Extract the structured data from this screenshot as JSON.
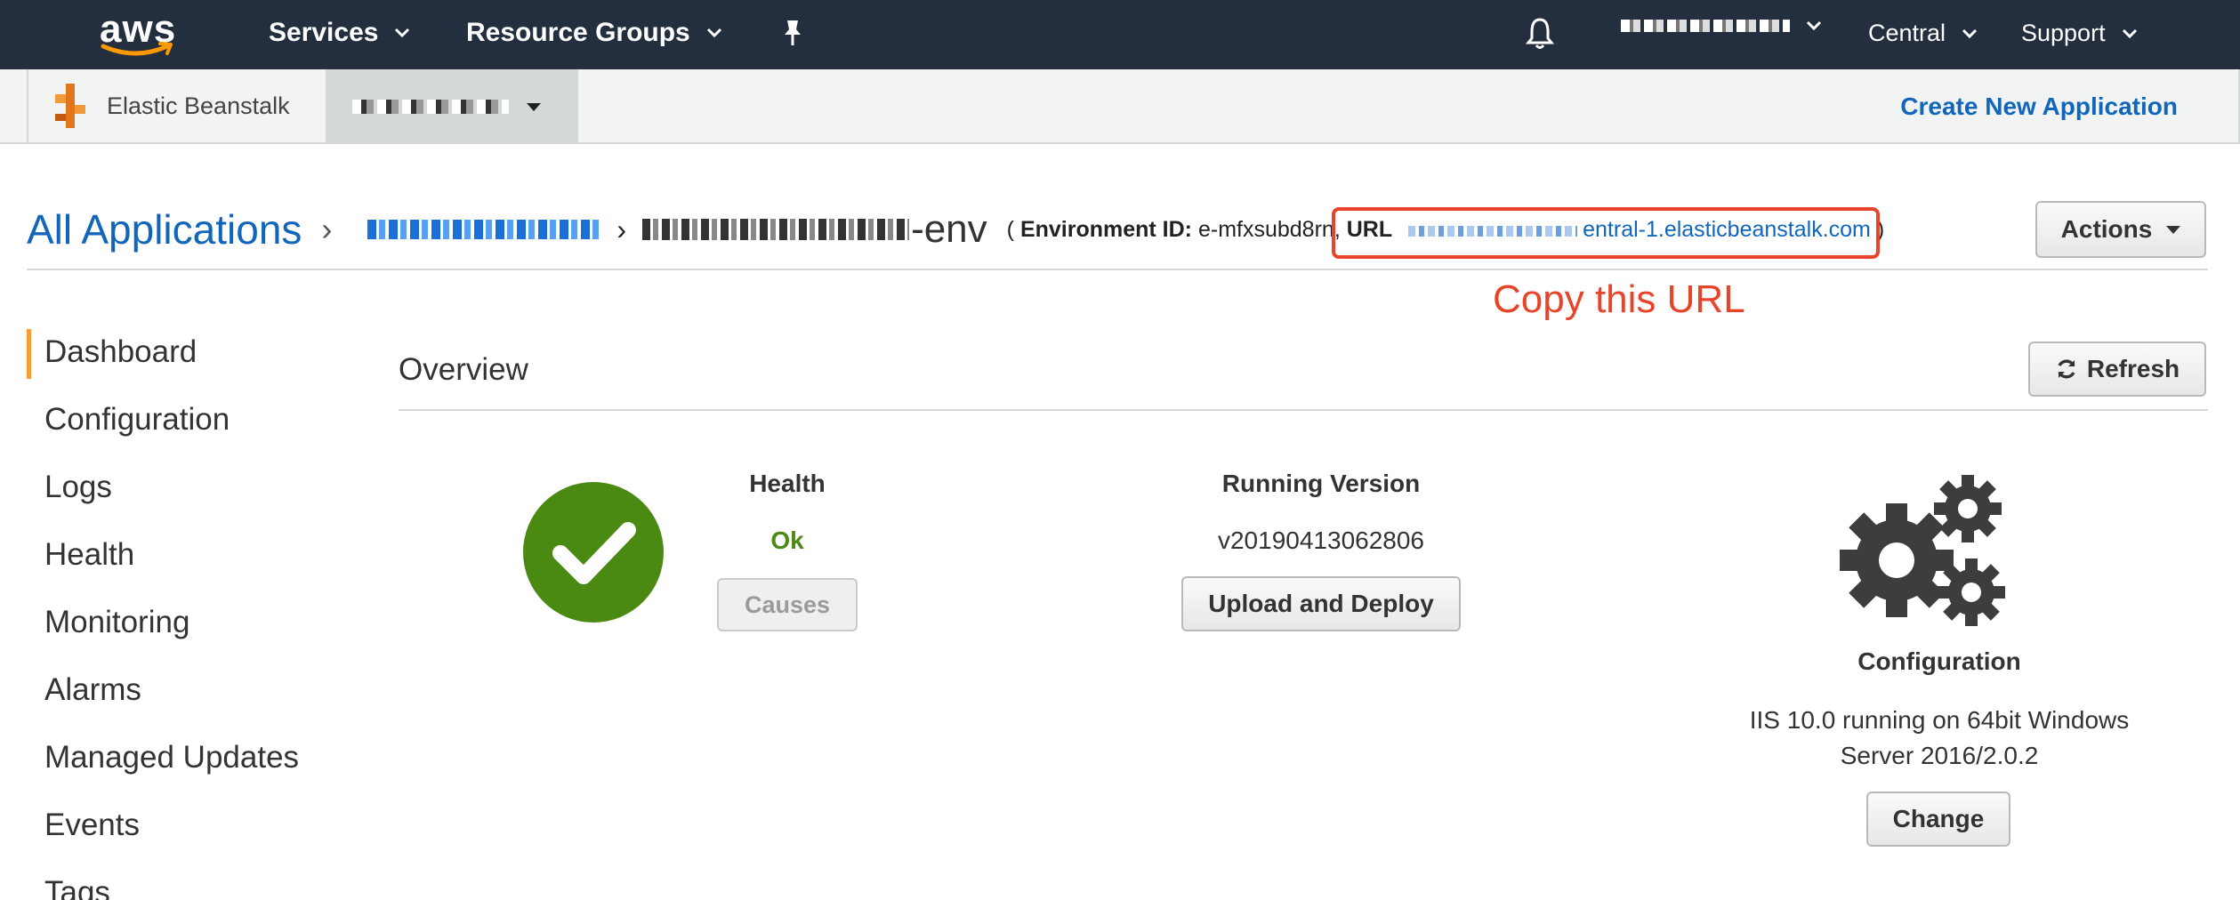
{
  "topnav": {
    "logo_text": "aws",
    "services": "Services",
    "resource_groups": "Resource Groups",
    "region": "Central",
    "support": "Support",
    "icons": [
      "pin-icon",
      "bell-icon"
    ]
  },
  "subnav": {
    "service_name": "Elastic Beanstalk",
    "create_new_application": "Create New Application"
  },
  "breadcrumb": {
    "all_applications": "All Applications",
    "env_suffix": "-env",
    "env_id_label": "Environment ID:",
    "env_id_value": "e-mfxsubd8rn,",
    "url_label": "URL",
    "url_value": "entral-1.elasticbeanstalk.com",
    "close_paren": ")",
    "open_paren": "("
  },
  "annotation": {
    "copy_note": "Copy this URL",
    "box_color": "#e8442a"
  },
  "actions_button": "Actions",
  "sidebar": {
    "items": [
      {
        "label": "Dashboard",
        "active": true
      },
      {
        "label": "Configuration"
      },
      {
        "label": "Logs"
      },
      {
        "label": "Health"
      },
      {
        "label": "Monitoring"
      },
      {
        "label": "Alarms"
      },
      {
        "label": "Managed Updates"
      },
      {
        "label": "Events"
      },
      {
        "label": "Tags"
      }
    ]
  },
  "overview": {
    "title": "Overview",
    "refresh": "Refresh",
    "health_label": "Health",
    "health_status": "Ok",
    "health_color": "#4b8a12",
    "causes": "Causes",
    "running_version_label": "Running Version",
    "running_version_value": "v20190413062806",
    "upload_deploy": "Upload and Deploy",
    "configuration_label": "Configuration",
    "configuration_line1": "IIS 10.0 running on 64bit Windows",
    "configuration_line2": "Server 2016/2.0.2",
    "change": "Change"
  },
  "colors": {
    "nav_bg": "#232f3e",
    "link": "#1166bb",
    "accent_orange": "#f59d33"
  }
}
